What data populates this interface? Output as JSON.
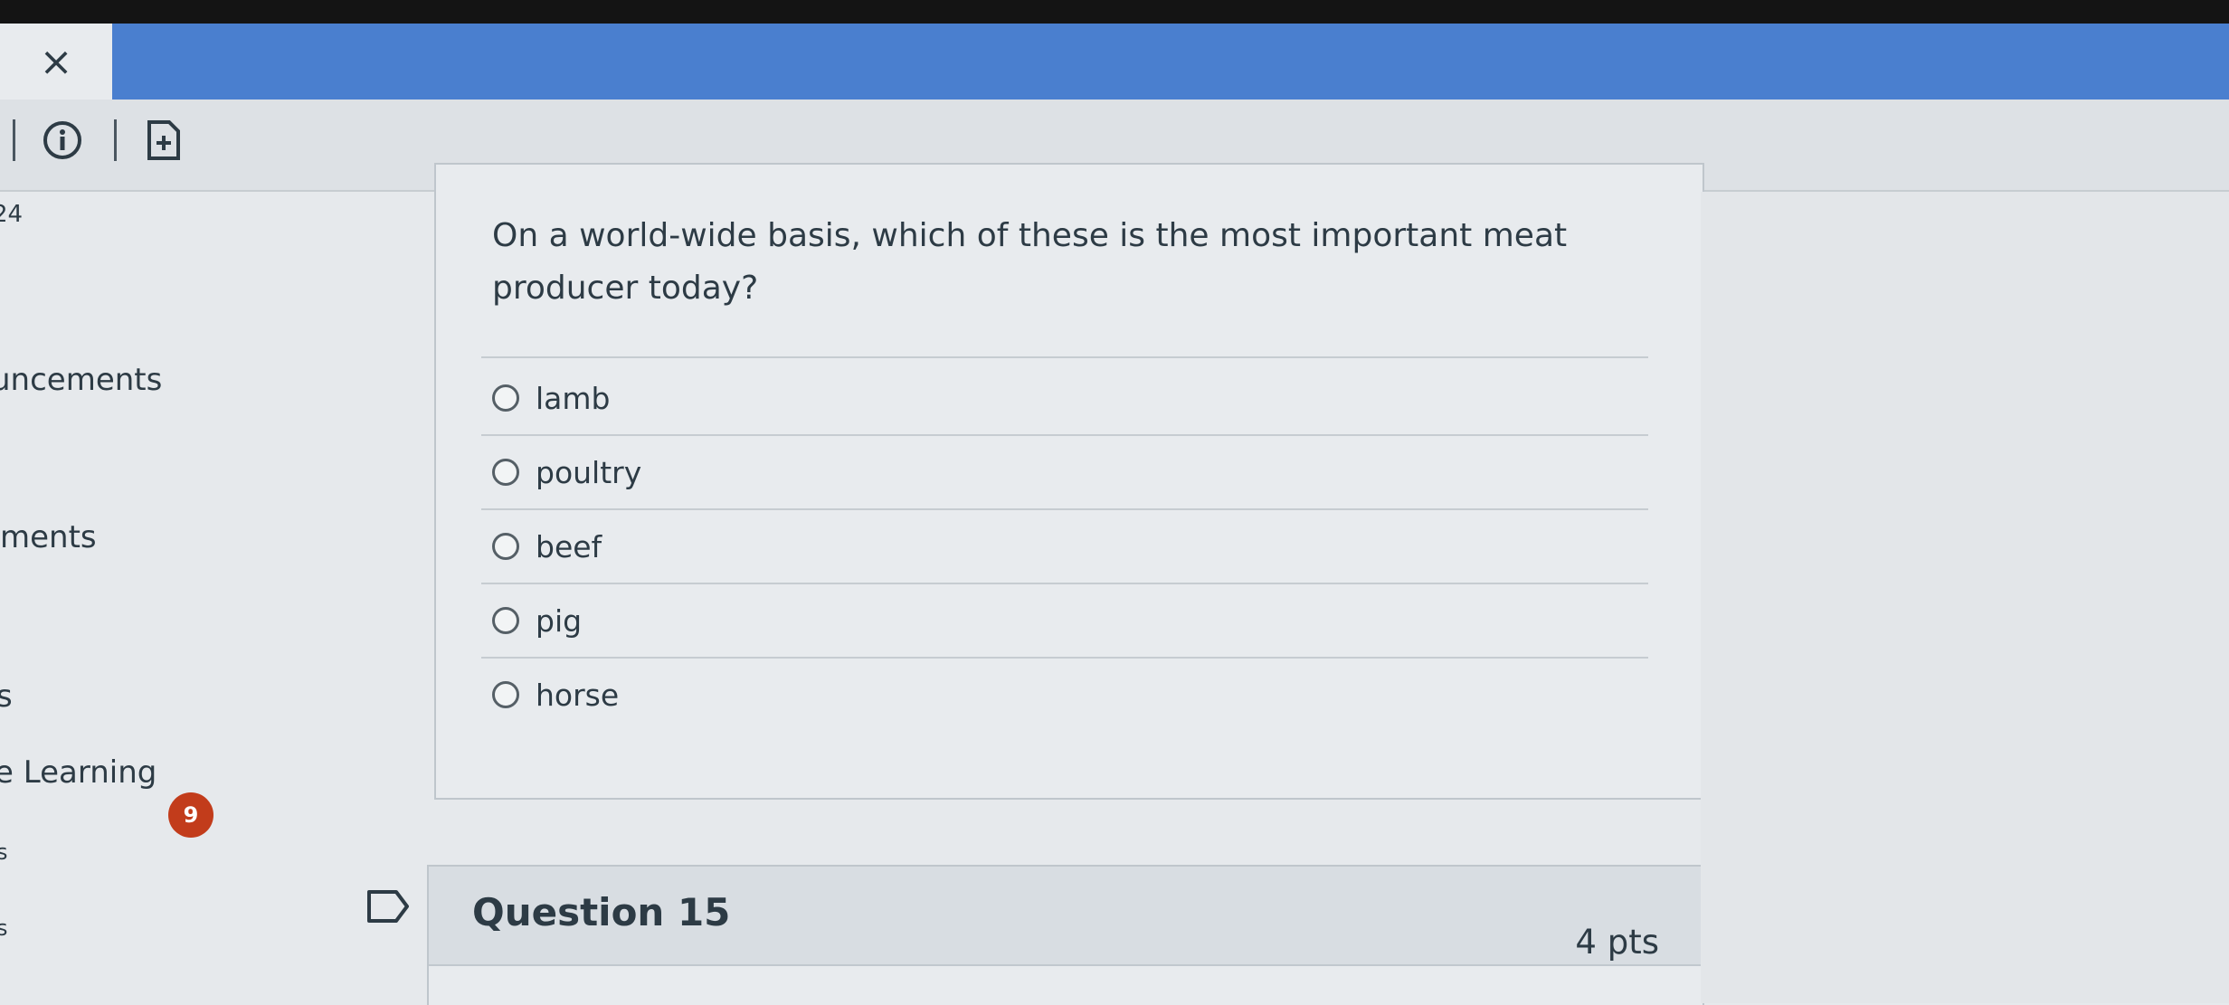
{
  "window": {
    "close_label": "×"
  },
  "toolbar": {
    "icons": [
      "info-icon",
      "add-file-icon"
    ]
  },
  "sidebar": {
    "items": [
      {
        "label": "24"
      },
      {
        "label": "uncements"
      },
      {
        "label": "ments"
      },
      {
        "label": "s"
      },
      {
        "label": "e Learning"
      },
      {
        "label": "s"
      },
      {
        "label": "s"
      }
    ],
    "badge_count": "9"
  },
  "question": {
    "text": "On a world-wide basis, which of these is the most important meat producer today?",
    "answers": [
      {
        "label": "lamb"
      },
      {
        "label": "poultry"
      },
      {
        "label": "beef"
      },
      {
        "label": "pig"
      },
      {
        "label": "horse"
      }
    ]
  },
  "next_question": {
    "title": "Question 15",
    "points": "4 pts"
  },
  "colors": {
    "topbar": "#4a7fcf",
    "badge": "#c23c1b",
    "text": "#2d3b45"
  }
}
